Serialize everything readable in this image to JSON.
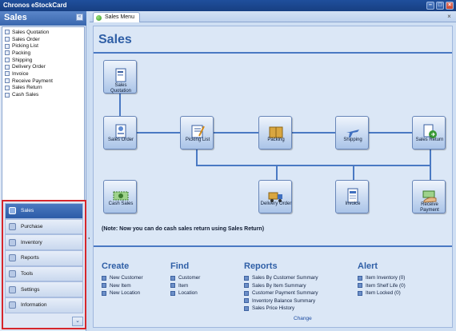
{
  "window": {
    "title": "Chronos eStockCard"
  },
  "left_panel": {
    "title": "Sales",
    "items": [
      {
        "label": "Sales Quotation"
      },
      {
        "label": "Sales Order"
      },
      {
        "label": "Picking List"
      },
      {
        "label": "Packing"
      },
      {
        "label": "Shipping"
      },
      {
        "label": "Delivery Order"
      },
      {
        "label": "Invoice"
      },
      {
        "label": "Receive Payment"
      },
      {
        "label": "Sales Return"
      },
      {
        "label": "Cash Sales"
      }
    ],
    "nav_buttons": [
      {
        "label": "Sales",
        "active": true
      },
      {
        "label": "Purchase"
      },
      {
        "label": "Inventory"
      },
      {
        "label": "Reports"
      },
      {
        "label": "Tools"
      },
      {
        "label": "Settings"
      },
      {
        "label": "Information"
      }
    ]
  },
  "tabs": [
    {
      "label": "Sales Menu"
    }
  ],
  "main": {
    "title": "Sales",
    "flow_nodes": [
      {
        "label": "Sales\nQuotation"
      },
      {
        "label": "Sales Order"
      },
      {
        "label": "Picking List"
      },
      {
        "label": "Packing"
      },
      {
        "label": "Shipping"
      },
      {
        "label": "Sales Return"
      },
      {
        "label": "Cash Sales"
      },
      {
        "label": "Delivery Order"
      },
      {
        "label": "Invoice"
      },
      {
        "label": "Receive\nPayment"
      }
    ],
    "note": "(Note: Now you can do cash sales return using Sales Return)",
    "create": {
      "title": "Create",
      "links": [
        {
          "label": "New Customer"
        },
        {
          "label": "New Item"
        },
        {
          "label": "New Location"
        }
      ]
    },
    "find": {
      "title": "Find",
      "links": [
        {
          "label": "Customer"
        },
        {
          "label": "Item"
        },
        {
          "label": "Location"
        }
      ]
    },
    "reports": {
      "title": "Reports",
      "links": [
        {
          "label": "Sales By Customer Summary"
        },
        {
          "label": "Sales By Item Summary"
        },
        {
          "label": "Customer Payment Summary"
        },
        {
          "label": "Inventory Balance Summary"
        },
        {
          "label": "Sales Price History"
        }
      ],
      "change_label": "Change"
    },
    "alert": {
      "title": "Alert",
      "links": [
        {
          "label": "Item Inventory (0)"
        },
        {
          "label": "Item Shelf Life (0)"
        },
        {
          "label": "Item Locked (0)"
        }
      ]
    }
  },
  "colors": {
    "accent": "#2f5fa6",
    "highlight_border": "#d6262c"
  }
}
